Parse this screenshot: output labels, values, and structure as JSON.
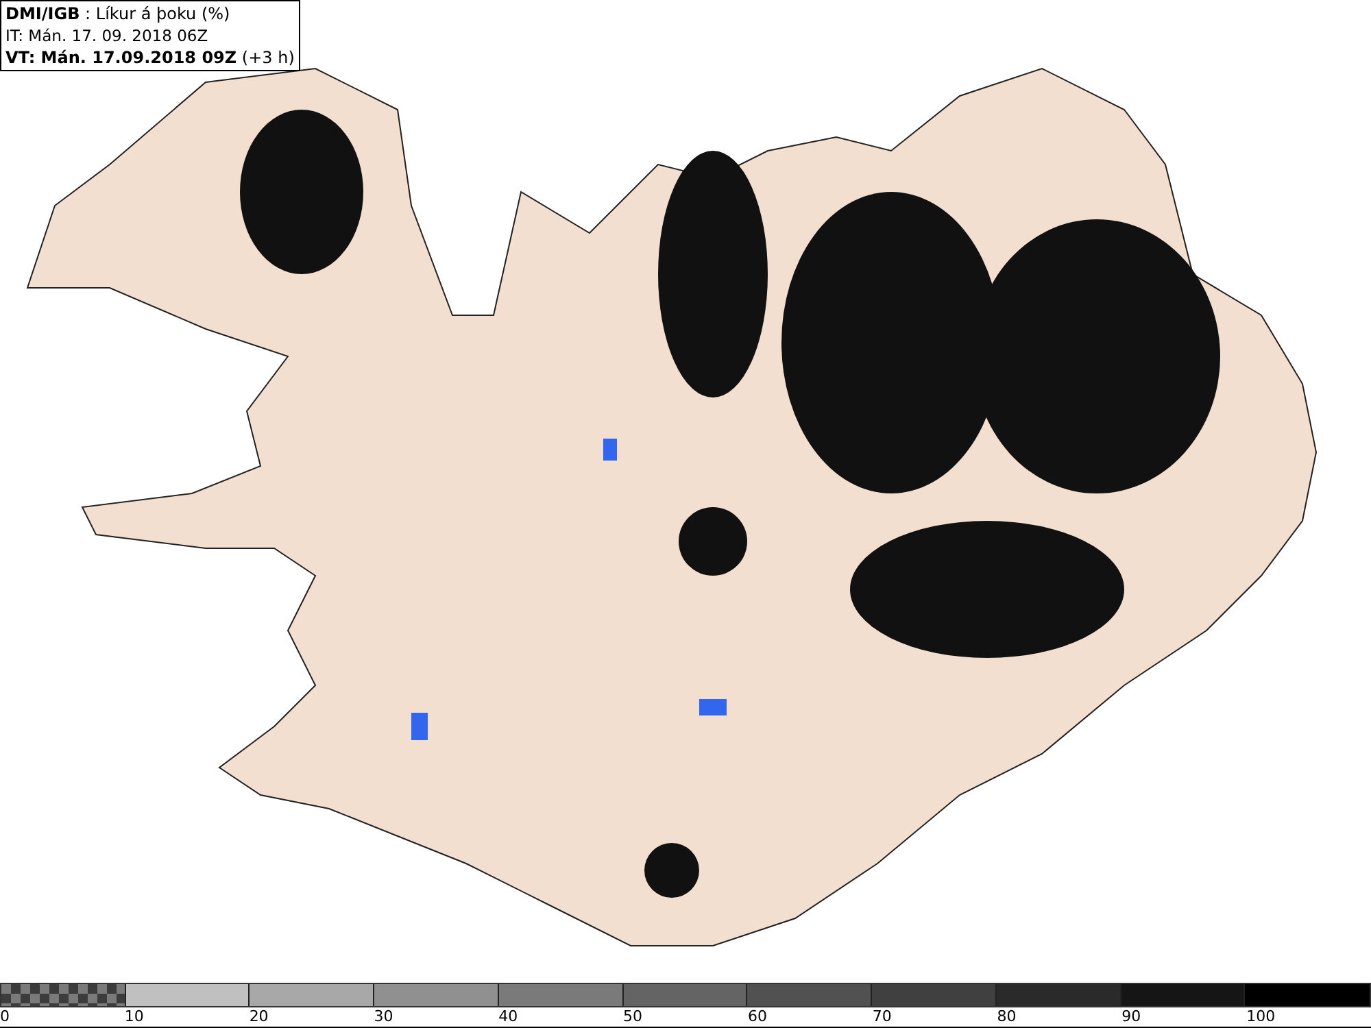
{
  "info_box": {
    "lines": [
      "**DMI/IGB** : Líkur á þoku (%)",
      "IT: Mán. 17. 09. 2018 06Z",
      "**VT: Mán. 17.09.2018 09Z** (+3 h)"
    ]
  },
  "legend": {
    "segments": [
      {
        "kind": "pattern",
        "color": "#7a7a7a"
      },
      {
        "kind": "solid",
        "color": "#c0c0c0"
      },
      {
        "kind": "solid",
        "color": "#a8a8a8"
      },
      {
        "kind": "solid",
        "color": "#909090"
      },
      {
        "kind": "solid",
        "color": "#7a7a7a"
      },
      {
        "kind": "solid",
        "color": "#646464"
      },
      {
        "kind": "solid",
        "color": "#515151"
      },
      {
        "kind": "solid",
        "color": "#404040"
      },
      {
        "kind": "solid",
        "color": "#2a2a2a"
      },
      {
        "kind": "solid",
        "color": "#151515"
      },
      {
        "kind": "solid",
        "color": "#000000"
      }
    ],
    "labels": [
      "0",
      "10",
      "20",
      "30",
      "40",
      "50",
      "60",
      "70",
      "80",
      "90",
      "100"
    ]
  }
}
